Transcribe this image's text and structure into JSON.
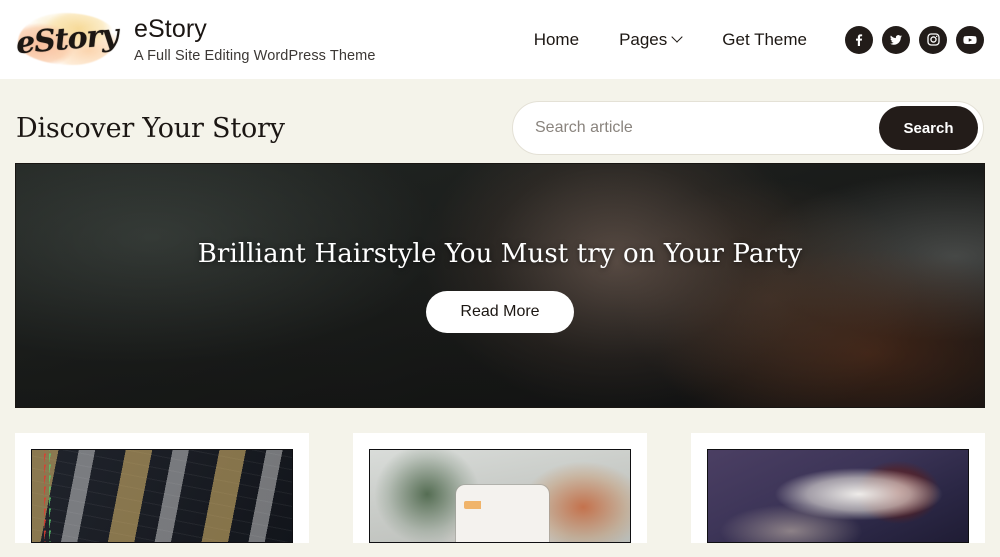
{
  "header": {
    "logo_text": "eStory",
    "logo_alt": "estory-watercolor-logo",
    "brand_name": "eStory",
    "brand_tagline": "A Full Site Editing WordPress Theme",
    "nav": [
      {
        "label": "Home",
        "has_dropdown": false
      },
      {
        "label": "Pages",
        "has_dropdown": true
      },
      {
        "label": "Get Theme",
        "has_dropdown": false
      }
    ],
    "social": [
      {
        "name": "facebook-icon"
      },
      {
        "name": "twitter-icon"
      },
      {
        "name": "instagram-icon"
      },
      {
        "name": "youtube-icon"
      }
    ]
  },
  "discover": {
    "title": "Discover Your Story"
  },
  "search": {
    "placeholder": "Search article",
    "value": "",
    "button_label": "Search"
  },
  "hero": {
    "title": "Brilliant Hairstyle You Must try on Your Party",
    "button_label": "Read More",
    "image_alt": "woman-with-curly-hair-portrait"
  },
  "cards": [
    {
      "image_alt": "dark-code-editor-screen"
    },
    {
      "image_alt": "hand-holding-phone-with-cactus"
    },
    {
      "image_alt": "space-shuttle-launch"
    }
  ],
  "colors": {
    "page_bg": "#f4f3ea",
    "header_bg": "#ffffff",
    "ink": "#1c1713",
    "button_dark": "#231c19",
    "card_bg": "#ffffff",
    "search_border": "#e4e1d6"
  }
}
